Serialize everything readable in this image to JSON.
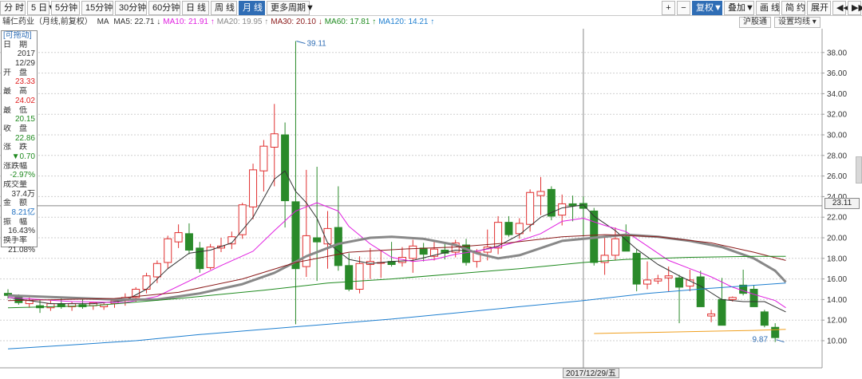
{
  "toolbar": {
    "left": [
      "分 时",
      "5 日▼",
      "5分钟",
      "15分钟",
      "30分钟",
      "60分钟",
      "日 线",
      "周 线",
      "月 线",
      "更多周期▼"
    ],
    "right": [
      "+",
      "−",
      "复权▼",
      "叠加▼",
      "画 线",
      "简 约",
      "展开",
      "◀◀",
      "▶▶"
    ],
    "active_left": "月 线",
    "active_right": "复权▼"
  },
  "legend": {
    "title": "辅仁药业（月线,前复权）",
    "indicator": "MA",
    "items": [
      {
        "label": "MA5: 22.71",
        "arrow": "↓",
        "color": "#333333"
      },
      {
        "label": "MA10: 21.91",
        "arrow": "↑",
        "color": "#e020e0"
      },
      {
        "label": "MA20: 19.95",
        "arrow": "↑",
        "color": "#888888"
      },
      {
        "label": "MA30: 20.10",
        "arrow": "↓",
        "color": "#8b1a1a"
      },
      {
        "label": "MA60: 17.81",
        "arrow": "↑",
        "color": "#1f8a1f"
      },
      {
        "label": "MA120: 14.21",
        "arrow": "↑",
        "color": "#1e7fd0"
      }
    ]
  },
  "right_buttons": [
    "沪股通",
    "设置均线 ▾"
  ],
  "info_panel": {
    "header": "[可拖动]",
    "rows": [
      {
        "label": "日　期",
        "value": "2017",
        "value2": "12/29",
        "value_color": "#333333"
      },
      {
        "label": "开　盘",
        "value": "23.33",
        "value_color": "#e02020"
      },
      {
        "label": "最　高",
        "value": "24.02",
        "value_color": "#e02020"
      },
      {
        "label": "最　低",
        "value": "20.15",
        "value_color": "#1f8a1f"
      },
      {
        "label": "收　盘",
        "value": "22.86",
        "value_color": "#1f8a1f"
      },
      {
        "label": "涨　跌",
        "value": "▼0.70",
        "value_color": "#1f8a1f"
      },
      {
        "label": "涨跌幅",
        "value": "-2.97%",
        "value_color": "#1f8a1f"
      },
      {
        "label": "成交量",
        "value": "37.4万",
        "value_color": "#333333"
      },
      {
        "label": "金　额",
        "value": "8.21亿",
        "value_color": "#1e6fc0"
      },
      {
        "label": "振　幅",
        "value": "16.43%",
        "value_color": "#333333"
      },
      {
        "label": "换手率",
        "value": "21.08%",
        "value_color": "#333333"
      }
    ]
  },
  "chart_data": {
    "type": "candlestick",
    "y_ticks": [
      "10.00",
      "12.00",
      "14.00",
      "16.00",
      "18.00",
      "20.00",
      "22.00",
      "24.00",
      "26.00",
      "28.00",
      "30.00",
      "32.00",
      "34.00",
      "36.00",
      "38.00"
    ],
    "ylim": [
      9.0,
      40.0
    ],
    "colors": {
      "up": "#e03030",
      "down": "#2a8a2a",
      "crosshair": "#888888"
    },
    "current_price": "23.11",
    "selected_date": "2017/12/29/五",
    "annotations": {
      "high_label": "39.11",
      "low_label": "9.87"
    },
    "candles": [
      [
        14.6,
        15.0,
        14.1,
        14.4
      ],
      [
        14.3,
        14.5,
        13.5,
        13.7
      ],
      [
        13.6,
        14.2,
        13.2,
        13.9
      ],
      [
        13.4,
        14.0,
        12.7,
        13.2
      ],
      [
        13.2,
        13.9,
        12.9,
        13.6
      ],
      [
        13.6,
        14.3,
        13.1,
        13.3
      ],
      [
        13.3,
        13.8,
        12.9,
        13.6
      ],
      [
        13.5,
        14.2,
        13.1,
        13.3
      ],
      [
        13.4,
        13.8,
        13.0,
        13.7
      ],
      [
        13.3,
        13.7,
        13.0,
        13.5
      ],
      [
        13.6,
        14.1,
        13.2,
        13.9
      ],
      [
        13.9,
        14.6,
        13.4,
        14.2
      ],
      [
        14.2,
        15.2,
        13.8,
        15.0
      ],
      [
        15.0,
        16.6,
        14.6,
        16.3
      ],
      [
        16.2,
        17.8,
        15.6,
        17.5
      ],
      [
        17.6,
        20.2,
        17.0,
        19.9
      ],
      [
        19.6,
        21.3,
        19.0,
        20.5
      ],
      [
        20.4,
        21.4,
        18.4,
        18.8
      ],
      [
        19.0,
        19.6,
        16.6,
        17.0
      ],
      [
        17.1,
        19.4,
        16.9,
        19.1
      ],
      [
        19.0,
        20.0,
        18.6,
        19.2
      ],
      [
        19.4,
        20.6,
        18.9,
        20.1
      ],
      [
        20.3,
        23.4,
        19.9,
        23.2
      ],
      [
        23.0,
        27.2,
        21.8,
        26.6
      ],
      [
        26.5,
        29.5,
        24.5,
        28.9
      ],
      [
        28.8,
        33.0,
        25.0,
        30.1
      ],
      [
        30.0,
        31.2,
        21.0,
        23.6
      ],
      [
        23.5,
        39.11,
        11.6,
        17.0
      ],
      [
        17.2,
        26.6,
        16.2,
        20.2
      ],
      [
        20.0,
        26.9,
        15.8,
        19.6
      ],
      [
        19.4,
        22.6,
        17.0,
        20.9
      ],
      [
        21.0,
        25.0,
        16.8,
        17.3
      ],
      [
        17.3,
        18.5,
        14.8,
        15.0
      ],
      [
        15.0,
        18.2,
        14.6,
        17.5
      ],
      [
        17.4,
        19.0,
        16.0,
        17.7
      ],
      [
        17.6,
        18.8,
        16.1,
        17.6
      ],
      [
        17.7,
        19.6,
        17.2,
        17.4
      ],
      [
        17.6,
        19.1,
        17.2,
        18.1
      ],
      [
        18.0,
        19.8,
        16.6,
        19.2
      ],
      [
        19.0,
        19.5,
        17.7,
        18.4
      ],
      [
        18.2,
        19.6,
        17.8,
        18.9
      ],
      [
        18.8,
        19.4,
        17.9,
        18.5
      ],
      [
        18.6,
        19.8,
        18.1,
        19.5
      ],
      [
        19.3,
        19.9,
        17.3,
        17.6
      ],
      [
        17.7,
        18.9,
        17.1,
        18.6
      ],
      [
        18.6,
        20.8,
        17.8,
        19.1
      ],
      [
        19.0,
        22.1,
        18.4,
        21.5
      ],
      [
        21.5,
        22.1,
        20.1,
        20.3
      ],
      [
        20.4,
        21.9,
        19.9,
        21.4
      ],
      [
        21.3,
        24.7,
        20.6,
        24.4
      ],
      [
        24.1,
        25.9,
        22.2,
        24.5
      ],
      [
        24.7,
        25.0,
        21.7,
        22.1
      ],
      [
        22.2,
        24.2,
        21.2,
        23.3
      ],
      [
        23.3,
        24.1,
        21.6,
        23.1
      ],
      [
        23.33,
        24.02,
        20.15,
        22.86
      ],
      [
        22.6,
        22.9,
        17.3,
        17.6
      ],
      [
        17.6,
        20.1,
        16.4,
        18.3
      ],
      [
        18.3,
        21.0,
        17.8,
        19.9
      ],
      [
        20.1,
        21.3,
        19.5,
        18.7
      ],
      [
        18.5,
        18.9,
        14.8,
        15.5
      ],
      [
        15.5,
        17.7,
        15.0,
        15.9
      ],
      [
        15.8,
        16.4,
        15.5,
        16.0
      ],
      [
        16.1,
        17.2,
        14.8,
        16.3
      ],
      [
        16.1,
        16.4,
        11.7,
        15.2
      ],
      [
        15.3,
        16.9,
        14.8,
        15.9
      ],
      [
        16.2,
        16.8,
        14.0,
        13.3
      ],
      [
        12.4,
        13.0,
        11.8,
        12.6
      ],
      [
        14.0,
        16.1,
        11.5,
        11.5
      ],
      [
        14.0,
        14.3,
        13.8,
        14.2
      ],
      [
        15.4,
        16.9,
        14.4,
        14.6
      ],
      [
        15.0,
        15.4,
        14.7,
        13.3
      ],
      [
        12.8,
        13.0,
        11.3,
        11.5
      ],
      [
        11.3,
        11.7,
        9.87,
        10.3
      ]
    ],
    "series": [
      {
        "name": "MA5",
        "color": "#333333",
        "width": 1,
        "values": [
          [
            0,
            14.2
          ],
          [
            4,
            13.6
          ],
          [
            8,
            13.6
          ],
          [
            11,
            13.9
          ],
          [
            13,
            15.0
          ],
          [
            15,
            17.0
          ],
          [
            17,
            18.5
          ],
          [
            19,
            18.8
          ],
          [
            21,
            19.5
          ],
          [
            23,
            22.0
          ],
          [
            25,
            25.7
          ],
          [
            26,
            26.5
          ],
          [
            27,
            24.5
          ],
          [
            28,
            23.4
          ],
          [
            29,
            21.9
          ],
          [
            30,
            19.5
          ],
          [
            32,
            17.9
          ],
          [
            34,
            17.5
          ],
          [
            36,
            17.7
          ],
          [
            38,
            17.8
          ],
          [
            40,
            18.3
          ],
          [
            42,
            18.8
          ],
          [
            44,
            18.7
          ],
          [
            46,
            19.2
          ],
          [
            48,
            20.3
          ],
          [
            50,
            22.0
          ],
          [
            52,
            22.9
          ],
          [
            54,
            23.2
          ],
          [
            55,
            22.1
          ],
          [
            57,
            20.7
          ],
          [
            59,
            18.9
          ],
          [
            61,
            17.4
          ],
          [
            63,
            16.3
          ],
          [
            65,
            15.3
          ],
          [
            67,
            14.0
          ],
          [
            69,
            13.8
          ],
          [
            71,
            13.8
          ],
          [
            73,
            12.8
          ]
        ]
      },
      {
        "name": "MA10",
        "color": "#e020e0",
        "width": 1,
        "values": [
          [
            0,
            14.2
          ],
          [
            6,
            13.8
          ],
          [
            11,
            13.7
          ],
          [
            14,
            14.3
          ],
          [
            17,
            15.8
          ],
          [
            20,
            17.3
          ],
          [
            23,
            18.7
          ],
          [
            25,
            20.7
          ],
          [
            27,
            22.6
          ],
          [
            29,
            23.4
          ],
          [
            31,
            22.6
          ],
          [
            32,
            21.1
          ],
          [
            34,
            19.4
          ],
          [
            36,
            18.1
          ],
          [
            38,
            17.7
          ],
          [
            40,
            17.9
          ],
          [
            42,
            18.4
          ],
          [
            44,
            18.7
          ],
          [
            46,
            19.1
          ],
          [
            48,
            19.7
          ],
          [
            50,
            20.4
          ],
          [
            52,
            21.6
          ],
          [
            54,
            21.9
          ],
          [
            56,
            21.2
          ],
          [
            58,
            20.6
          ],
          [
            60,
            19.2
          ],
          [
            62,
            17.8
          ],
          [
            64,
            17.0
          ],
          [
            66,
            16.2
          ],
          [
            68,
            15.2
          ],
          [
            70,
            14.5
          ],
          [
            72,
            13.9
          ],
          [
            73,
            13.2
          ]
        ]
      },
      {
        "name": "MA20",
        "color": "#888888",
        "width": 3,
        "values": [
          [
            0,
            14.4
          ],
          [
            5,
            14.2
          ],
          [
            10,
            14.0
          ],
          [
            14,
            14.0
          ],
          [
            18,
            14.6
          ],
          [
            22,
            15.5
          ],
          [
            25,
            16.6
          ],
          [
            28,
            18.2
          ],
          [
            31,
            19.4
          ],
          [
            34,
            20.0
          ],
          [
            36,
            20.1
          ],
          [
            39,
            19.9
          ],
          [
            42,
            19.3
          ],
          [
            44,
            18.5
          ],
          [
            46,
            18.0
          ],
          [
            48,
            18.3
          ],
          [
            50,
            19.0
          ],
          [
            52,
            19.7
          ],
          [
            55,
            20.0
          ],
          [
            58,
            20.3
          ],
          [
            61,
            20.1
          ],
          [
            64,
            19.7
          ],
          [
            67,
            19.1
          ],
          [
            70,
            18.0
          ],
          [
            72,
            16.8
          ],
          [
            73,
            15.7
          ]
        ]
      },
      {
        "name": "MA30",
        "color": "#8b1a1a",
        "width": 1,
        "values": [
          [
            0,
            13.9
          ],
          [
            10,
            14.1
          ],
          [
            16,
            14.7
          ],
          [
            22,
            16.0
          ],
          [
            27,
            17.6
          ],
          [
            32,
            18.6
          ],
          [
            37,
            18.9
          ],
          [
            42,
            19.1
          ],
          [
            47,
            19.5
          ],
          [
            52,
            20.1
          ],
          [
            56,
            20.3
          ],
          [
            61,
            20.1
          ],
          [
            66,
            19.5
          ],
          [
            70,
            18.6
          ],
          [
            73,
            17.8
          ]
        ]
      },
      {
        "name": "MA60",
        "color": "#1f8a1f",
        "width": 1,
        "values": [
          [
            0,
            13.2
          ],
          [
            8,
            13.4
          ],
          [
            16,
            14.1
          ],
          [
            24,
            14.9
          ],
          [
            30,
            15.6
          ],
          [
            36,
            16.0
          ],
          [
            42,
            16.5
          ],
          [
            48,
            17.0
          ],
          [
            54,
            17.6
          ],
          [
            58,
            17.9
          ],
          [
            64,
            18.1
          ],
          [
            70,
            18.2
          ],
          [
            73,
            18.2
          ]
        ]
      },
      {
        "name": "MA120",
        "color": "#1e7fd0",
        "width": 1,
        "values": [
          [
            0,
            9.2
          ],
          [
            6,
            9.6
          ],
          [
            12,
            10.0
          ],
          [
            18,
            10.6
          ],
          [
            24,
            11.1
          ],
          [
            30,
            11.6
          ],
          [
            36,
            12.1
          ],
          [
            42,
            12.7
          ],
          [
            48,
            13.3
          ],
          [
            54,
            13.9
          ],
          [
            60,
            14.6
          ],
          [
            66,
            15.1
          ],
          [
            73,
            15.6
          ]
        ]
      },
      {
        "name": "MA250",
        "color": "#f0a020",
        "width": 1,
        "values": [
          [
            55,
            10.7
          ],
          [
            60,
            10.8
          ],
          [
            65,
            10.9
          ],
          [
            70,
            11.0
          ],
          [
            73,
            11.1
          ]
        ]
      }
    ]
  }
}
